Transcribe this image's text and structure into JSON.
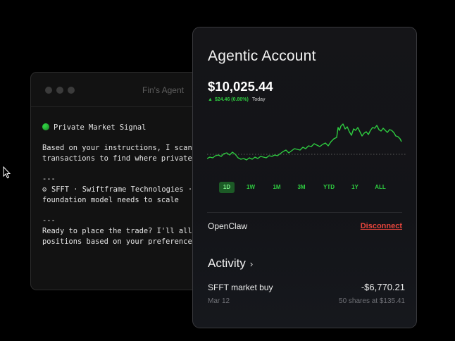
{
  "terminal": {
    "title": "Fin's Agent",
    "signal_label": "Private Market Signal",
    "lines": [
      "Based on your instructions, I scanned",
      "transactions to find where private",
      "---",
      "SFFT · Swiftframe Technologies · ",
      "foundation model needs to scale",
      "---",
      "Ready to place the trade? I'll allo",
      "positions based on your preferences"
    ]
  },
  "account": {
    "title": "Agentic Account",
    "balance": "$10,025.44",
    "change": "$24.46 (0.80%)",
    "change_period": "Today",
    "ranges": [
      "1D",
      "1W",
      "1M",
      "3M",
      "YTD",
      "1Y",
      "ALL"
    ],
    "active_range": "1D",
    "connection_name": "OpenClaw",
    "disconnect_label": "Disconnect",
    "activity_label": "Activity",
    "transaction": {
      "name": "SFFT market buy",
      "amount": "-$6,770.21",
      "date": "Mar 12",
      "detail": "50 shares at $135.41"
    }
  },
  "colors": {
    "positive": "#2ecc40",
    "negative": "#e8453c",
    "background": "#000000"
  },
  "icons": [
    "cursor-arrow-icon",
    "green-dot-icon",
    "gear-icon",
    "up-triangle-icon",
    "chevron-right-icon"
  ]
}
